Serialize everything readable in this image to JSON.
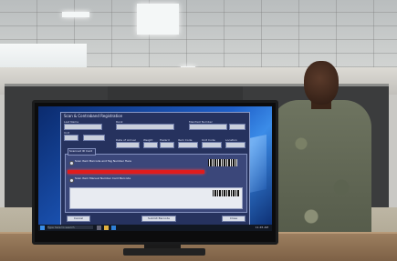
{
  "app": {
    "title": "Scan & Contraband Registration",
    "fields": [
      {
        "label": "Last Name",
        "value": ""
      },
      {
        "label": "Rank",
        "value": ""
      },
      {
        "label": "Manifest Number",
        "value": ""
      },
      {
        "label": "Unit",
        "value": ""
      },
      {
        "label": "Date of Arrival",
        "value": ""
      },
      {
        "label": "Weight",
        "value": ""
      },
      {
        "label": "Hazard",
        "value": ""
      },
      {
        "label": "Item Code",
        "value": ""
      },
      {
        "label": "Unit Code",
        "value": ""
      },
      {
        "label": "Location",
        "value": ""
      }
    ],
    "panel": {
      "tab_label": "Scanned ID Card",
      "rows": [
        {
          "label": "Scan Item Barcode and Tag Number Here"
        },
        {
          "label": "Scan Item Manual Number Card Barcode"
        }
      ]
    },
    "buttons": {
      "cancel": "Cancel",
      "save": "Submit Barcode",
      "close": "Close"
    }
  },
  "taskbar": {
    "search_placeholder": "Type here to search",
    "clock": "11:45 AM"
  },
  "colors": {
    "desktop": "#1f5fc8",
    "app_bg": "#26325e",
    "scan_beam": "#e01c1c",
    "uniform": "#6e7460"
  },
  "icons": [
    "windows-start-icon",
    "search-icon",
    "task-view-icon",
    "folder-icon",
    "browser-icon"
  ]
}
